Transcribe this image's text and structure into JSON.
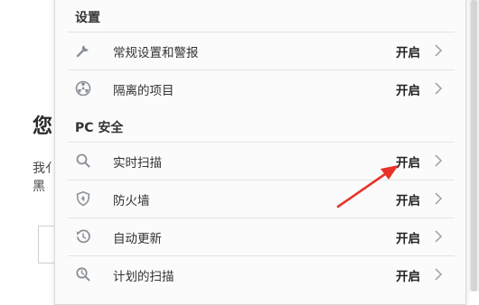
{
  "background_page": {
    "heading_partial": "您",
    "line1_partial": "我亻",
    "line2_partial": "黑"
  },
  "settings": {
    "section_settings": "设置",
    "section_pc_security": "PC 安全",
    "items": [
      {
        "label": "常规设置和警报",
        "status": "开启",
        "icon": "wrench-icon"
      },
      {
        "label": "隔离的项目",
        "status": "开启",
        "icon": "quarantine-icon"
      },
      {
        "label": "实时扫描",
        "status": "开启",
        "icon": "search-icon"
      },
      {
        "label": "防火墙",
        "status": "开启",
        "icon": "shield-icon"
      },
      {
        "label": "自动更新",
        "status": "开启",
        "icon": "update-icon"
      },
      {
        "label": "计划的扫描",
        "status": "开启",
        "icon": "scheduled-scan-icon"
      }
    ]
  },
  "colors": {
    "icon": "#8a9097",
    "annotation_arrow": "#e8332a"
  }
}
